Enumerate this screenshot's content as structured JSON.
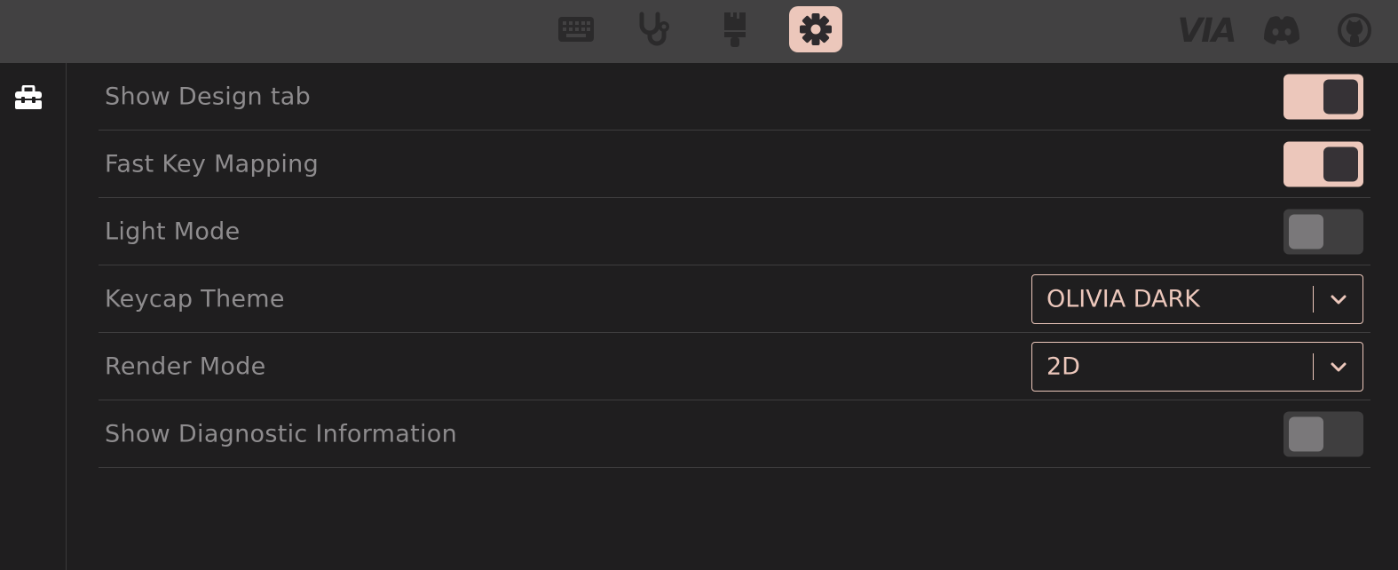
{
  "top_nav": {
    "items": [
      {
        "name": "keyboard-icon",
        "active": false
      },
      {
        "name": "stethoscope-icon",
        "active": false
      },
      {
        "name": "paintbrush-icon",
        "active": false
      },
      {
        "name": "gear-icon",
        "active": true
      }
    ],
    "external": [
      {
        "name": "via-logo",
        "text": "VIA"
      },
      {
        "name": "discord-icon"
      },
      {
        "name": "github-icon"
      }
    ]
  },
  "sidebar": {
    "items": [
      {
        "name": "toolbox-icon"
      }
    ]
  },
  "settings": {
    "rows": [
      {
        "label": "Show Design tab",
        "control": "toggle",
        "state": "on"
      },
      {
        "label": "Fast Key Mapping",
        "control": "toggle",
        "state": "on"
      },
      {
        "label": "Light Mode",
        "control": "toggle",
        "state": "off"
      },
      {
        "label": "Keycap Theme",
        "control": "select",
        "value": "OLIVIA DARK"
      },
      {
        "label": "Render Mode",
        "control": "select",
        "value": "2D"
      },
      {
        "label": "Show Diagnostic Information",
        "control": "toggle",
        "state": "off"
      }
    ]
  },
  "colors": {
    "accent": "#ecc7bb",
    "topbar": "#424142",
    "background": "#1f1e1f",
    "label_text": "#8e8c8e",
    "toggle_off_track": "#3f3e3f"
  }
}
